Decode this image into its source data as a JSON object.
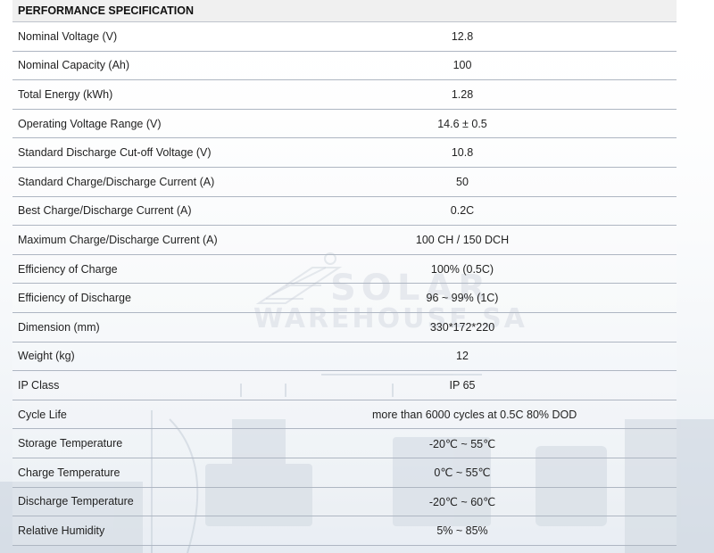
{
  "table": {
    "title": "PERFORMANCE SPECIFICATION",
    "rows": [
      {
        "label": "Nominal Voltage (V)",
        "value": "12.8"
      },
      {
        "label": "Nominal Capacity (Ah)",
        "value": "100"
      },
      {
        "label": "Total Energy (kWh)",
        "value": "1.28"
      },
      {
        "label": "Operating Voltage Range (V)",
        "value": "14.6 ± 0.5"
      },
      {
        "label": "Standard Discharge Cut-off Voltage (V)",
        "value": "10.8"
      },
      {
        "label": "Standard Charge/Discharge Current (A)",
        "value": "50"
      },
      {
        "label": "Best Charge/Discharge Current (A)",
        "value": "0.2C"
      },
      {
        "label": "Maximum Charge/Discharge Current (A)",
        "value": "100 CH / 150 DCH"
      },
      {
        "label": "Efficiency of Charge",
        "value": "100% (0.5C)"
      },
      {
        "label": "Efficiency of Discharge",
        "value": "96 ~ 99% (1C)"
      },
      {
        "label": "Dimension (mm)",
        "value": "330*172*220"
      },
      {
        "label": "Weight (kg)",
        "value": "12"
      },
      {
        "label": "IP Class",
        "value": "IP 65"
      },
      {
        "label": "Cycle Life",
        "value": "more than 6000 cycles at 0.5C 80% DOD"
      },
      {
        "label": "Storage Temperature",
        "value": "-20℃ ~ 55℃"
      },
      {
        "label": "Charge Temperature",
        "value": "0℃ ~ 55℃"
      },
      {
        "label": "Discharge Temperature",
        "value": "-20℃ ~ 60℃"
      },
      {
        "label": "Relative Humidity",
        "value": "5% ~ 85%"
      }
    ]
  },
  "watermark": {
    "line1": "SOLAR",
    "line2": "WAREHOUSE SA"
  }
}
